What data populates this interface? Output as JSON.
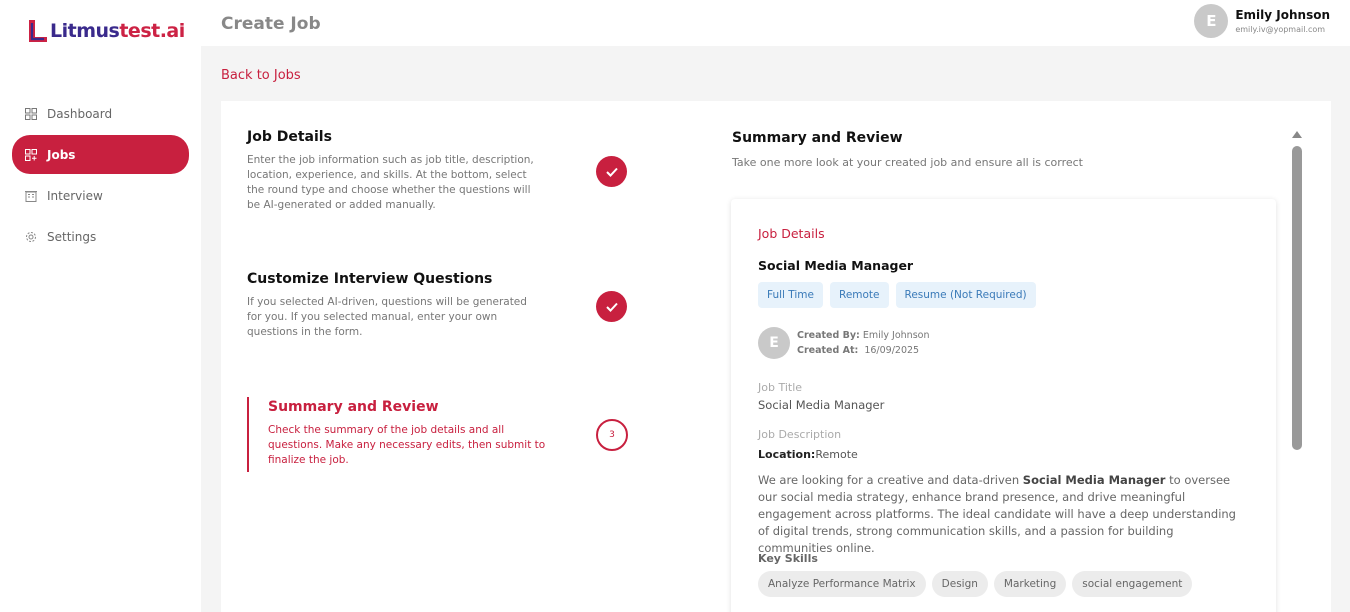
{
  "brand": {
    "logo_text_1": "Litmus",
    "logo_text_2": "test.ai",
    "accent": "#c8203f"
  },
  "sidebar": {
    "items": [
      {
        "label": "Dashboard",
        "icon": "grid-icon",
        "active": false
      },
      {
        "label": "Jobs",
        "icon": "jobs-grid-icon",
        "active": true
      },
      {
        "label": "Interview",
        "icon": "building-icon",
        "active": false
      },
      {
        "label": "Settings",
        "icon": "gear-icon",
        "active": false
      }
    ]
  },
  "header": {
    "title": "Create Job",
    "user": {
      "initial": "E",
      "name": "Emily Johnson",
      "email": "emily.iv@yopmail.com"
    }
  },
  "back_link": "Back to Jobs",
  "steps": [
    {
      "title": "Job Details",
      "description": "Enter the job information such as job title, description, location, experience, and skills. At the bottom, select the round type and choose whether the questions will be AI-generated or added manually.",
      "status": "complete"
    },
    {
      "title": "Customize Interview Questions",
      "description": "If you selected AI-driven, questions will be generated for you. If you selected manual, enter your own questions in the form.",
      "status": "complete"
    },
    {
      "title": "Summary and Review",
      "description": "Check the summary of the job details and all questions. Make any necessary edits, then submit to finalize the job.",
      "status": "active",
      "number": "3"
    }
  ],
  "summary": {
    "title": "Summary and Review",
    "subtitle": "Take one more look at your created job and ensure all is correct",
    "section_heading": "Job Details",
    "job_name": "Social Media Manager",
    "tags": [
      "Full Time",
      "Remote",
      "Resume (Not Required)"
    ],
    "creator": {
      "initial": "E",
      "created_by_label": "Created By:",
      "created_by": "Emily Johnson",
      "created_at_label": "Created At:",
      "created_at": "16/09/2025"
    },
    "job_title_label": "Job Title",
    "job_title": "Social Media Manager",
    "job_description_label": "Job Description",
    "location_label": "Location:",
    "location": "Remote",
    "description_pre": "We are looking for a creative and data-driven ",
    "description_bold": "Social Media Manager",
    "description_post": " to oversee our social media strategy, enhance brand presence, and drive meaningful engagement across platforms. The ideal candidate will have a deep understanding of digital trends, strong communication skills, and a passion for building communities online.",
    "key_skills_label": "Key Skills",
    "skills": [
      "Analyze Performance Matrix",
      "Design",
      "Marketing",
      "social engagement"
    ]
  }
}
